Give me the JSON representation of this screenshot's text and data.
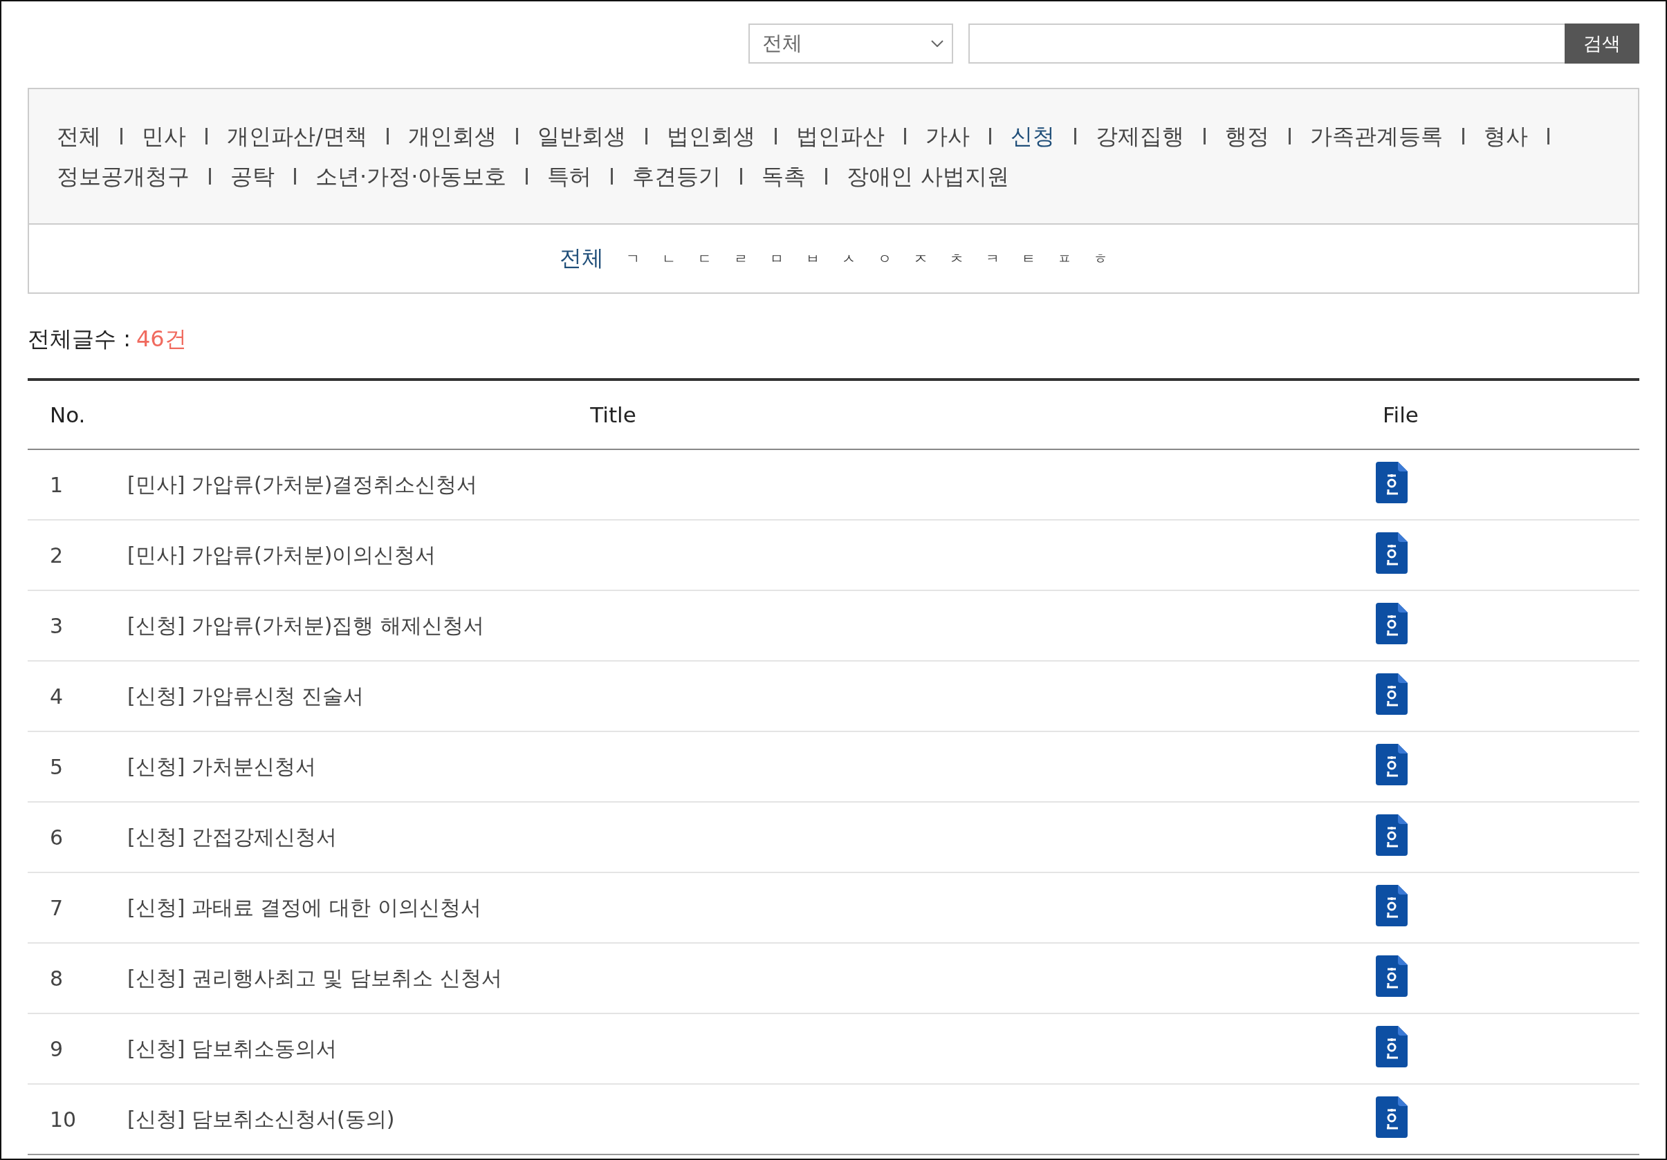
{
  "search": {
    "select_value": "전체",
    "button": "검색"
  },
  "categories": [
    {
      "label": "전체",
      "selected": false
    },
    {
      "label": "민사",
      "selected": false
    },
    {
      "label": "개인파산/면책",
      "selected": false
    },
    {
      "label": "개인회생",
      "selected": false
    },
    {
      "label": "일반회생",
      "selected": false
    },
    {
      "label": "법인회생",
      "selected": false
    },
    {
      "label": "법인파산",
      "selected": false
    },
    {
      "label": "가사",
      "selected": false
    },
    {
      "label": "신청",
      "selected": true
    },
    {
      "label": "강제집행",
      "selected": false
    },
    {
      "label": "행정",
      "selected": false
    },
    {
      "label": "가족관계등록",
      "selected": false
    },
    {
      "label": "형사",
      "selected": false
    },
    {
      "label": "정보공개청구",
      "selected": false
    },
    {
      "label": "공탁",
      "selected": false
    },
    {
      "label": "소년·가정·아동보호",
      "selected": false
    },
    {
      "label": "특허",
      "selected": false
    },
    {
      "label": "후견등기",
      "selected": false
    },
    {
      "label": "독촉",
      "selected": false
    },
    {
      "label": "장애인 사법지원",
      "selected": false
    }
  ],
  "consonants": [
    {
      "label": "전체",
      "selected": true
    },
    {
      "label": "ㄱ",
      "selected": false
    },
    {
      "label": "ㄴ",
      "selected": false
    },
    {
      "label": "ㄷ",
      "selected": false
    },
    {
      "label": "ㄹ",
      "selected": false
    },
    {
      "label": "ㅁ",
      "selected": false
    },
    {
      "label": "ㅂ",
      "selected": false
    },
    {
      "label": "ㅅ",
      "selected": false
    },
    {
      "label": "ㅇ",
      "selected": false
    },
    {
      "label": "ㅈ",
      "selected": false
    },
    {
      "label": "ㅊ",
      "selected": false
    },
    {
      "label": "ㅋ",
      "selected": false
    },
    {
      "label": "ㅌ",
      "selected": false
    },
    {
      "label": "ㅍ",
      "selected": false
    },
    {
      "label": "ㅎ",
      "selected": false
    }
  ],
  "total": {
    "label": "전체글수 :",
    "count": "46건"
  },
  "table": {
    "columns": [
      "No.",
      "Title",
      "File"
    ],
    "rows": [
      {
        "no": "1",
        "title": "[민사] 가압류(가처분)결정취소신청서"
      },
      {
        "no": "2",
        "title": "[민사] 가압류(가처분)이의신청서"
      },
      {
        "no": "3",
        "title": "[신청] 가압류(가처분)집행 해제신청서"
      },
      {
        "no": "4",
        "title": "[신청] 가압류신청 진술서"
      },
      {
        "no": "5",
        "title": "[신청] 가처분신청서"
      },
      {
        "no": "6",
        "title": "[신청] 간접강제신청서"
      },
      {
        "no": "7",
        "title": "[신청] 과태료 결정에 대한 이의신청서"
      },
      {
        "no": "8",
        "title": "[신청] 권리행사최고 및 담보취소 신청서"
      },
      {
        "no": "9",
        "title": "[신청] 담보취소동의서"
      },
      {
        "no": "10",
        "title": "[신청] 담보취소신청서(동의)"
      }
    ]
  }
}
